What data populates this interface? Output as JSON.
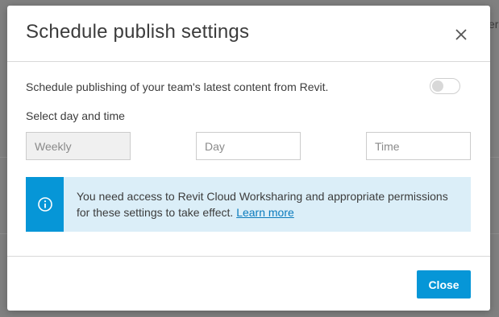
{
  "background": {
    "partial_text": "er"
  },
  "modal": {
    "title": "Schedule publish settings",
    "close_icon": "close-icon",
    "schedule_label": "Schedule publishing of your team's latest content from Revit.",
    "toggle_on": false,
    "select_label": "Select day and time",
    "fields": {
      "frequency_placeholder": "Weekly",
      "day_placeholder": "Day",
      "time_placeholder": "Time"
    },
    "info": {
      "icon": "info-icon",
      "text": "You need access to Revit Cloud Worksharing and appropriate permissions for these settings to take effect.",
      "link": "Learn more"
    },
    "footer": {
      "close_label": "Close"
    }
  },
  "colors": {
    "accent": "#0696d7",
    "info_background": "#dbeef8",
    "link": "#0a7bbd"
  }
}
